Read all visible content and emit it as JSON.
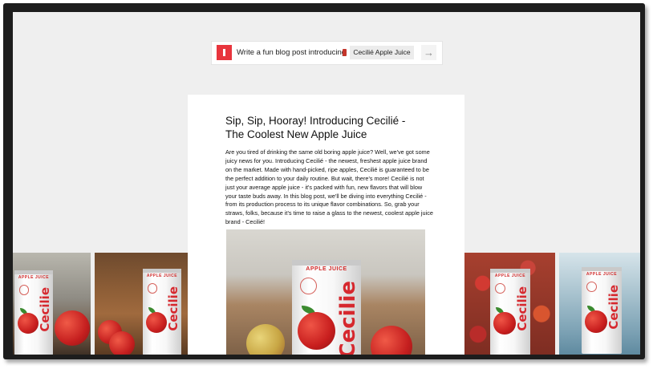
{
  "prompt": {
    "text": "Write a fun blog post introducing",
    "product_chip": "Cecilié Apple Juice",
    "send_icon": "arrow-right-icon",
    "logo_icon": "app-logo-icon"
  },
  "article": {
    "title": "Sip, Sip, Hooray! Introducing Cecilié - The Coolest New Apple Juice",
    "body": "Are you tired of drinking the same old boring apple juice? Well, we've got some juicy news for you. Introducing Cecilié - the newest, freshest apple juice brand on the market. Made with hand-picked, ripe apples, Cecilié is guaranteed to be the perfect addition to your daily routine. But wait, there's more! Cecilié is not just your average apple juice - it's packed with fun, new flavors that will blow your taste buds away. In this blog post, we'll be diving into everything Cecilié - from its production process to its unique flavor combinations. So, grab your straws, folks, because it's time to raise a glass to the newest, coolest apple juice brand - Cecilié!"
  },
  "can": {
    "label": "APPLE JUICE",
    "brand": "Cecilie"
  },
  "colors": {
    "accent": "#e8353d",
    "background": "#efefef"
  }
}
